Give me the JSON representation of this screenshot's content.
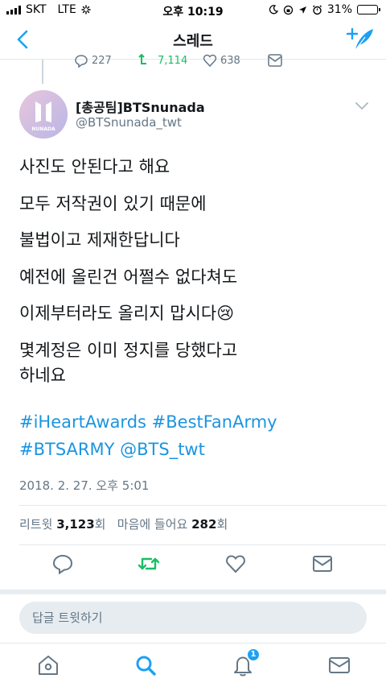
{
  "status_bar": {
    "carrier": "SKT",
    "network": "LTE",
    "time": "오후 10:19",
    "battery_percent_label": "31%",
    "battery_level": 0.31
  },
  "nav": {
    "title": "스레드"
  },
  "previous_tweet": {
    "replies": "227",
    "retweets": "7,114",
    "likes": "638"
  },
  "tweet": {
    "display_name": "[총공팀]BTSnunada",
    "username": "@BTSnunada_twt",
    "avatar_text": "NUNADA",
    "lines": [
      "사진도 안된다고 해요",
      "모두 저작권이 있기 때문에",
      "불법이고 제재한답니다",
      "예전에 올린건 어쩔수 없다쳐도",
      "이제부터라도 올리지 맙시다😢",
      "몇계정은 이미 정지를 당했다고",
      "하네요"
    ],
    "tags_line1": "#iHeartAwards #BestFanArmy",
    "tags_line2": "#BTSARMY @BTS_twt",
    "timestamp": "2018. 2. 27. 오후 5:01",
    "stats": {
      "retweets_label": "리트윗",
      "retweets_count": "3,123",
      "retweets_unit": "회",
      "likes_label": "마음에 들어요",
      "likes_count": "282",
      "likes_unit": "회"
    }
  },
  "reply": {
    "placeholder": "답글 트윗하기"
  },
  "tabs": {
    "notifications_badge": "1"
  },
  "colors": {
    "accent": "#1da1f2",
    "retweet_green": "#17bf63",
    "secondary_text": "#657786"
  }
}
